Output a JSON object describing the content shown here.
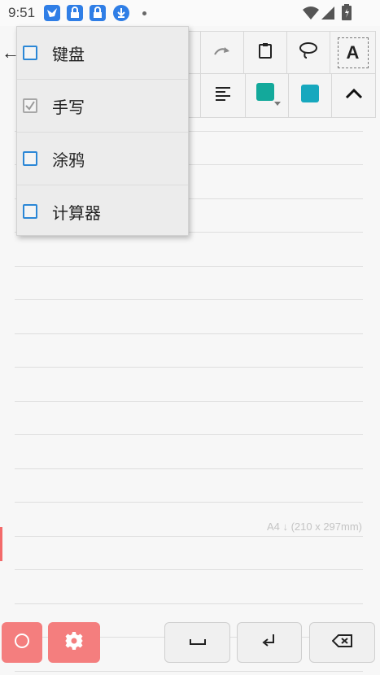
{
  "status_bar": {
    "time": "9:51",
    "icons": [
      "bird-app-icon",
      "lock-app-icon",
      "lock-app-icon",
      "download-icon"
    ],
    "right_icons": [
      "wifi-icon",
      "cell-signal-icon",
      "battery-icon"
    ]
  },
  "toolbar": {
    "row1": [
      "redo-icon",
      "clipboard-icon",
      "lasso-icon",
      "text-box-icon"
    ],
    "row2": [
      "align-left-icon",
      "pen-color-icon",
      "fill-color-icon",
      "collapse-icon"
    ],
    "text_box_letter": "A",
    "colors": {
      "pen": "#13a99b",
      "fill": "#17a8be"
    }
  },
  "menu": {
    "items": [
      {
        "label": "键盘",
        "checked": false
      },
      {
        "label": "手写",
        "checked": true
      },
      {
        "label": "涂鸦",
        "checked": false
      },
      {
        "label": "计算器",
        "checked": false
      }
    ]
  },
  "paper": {
    "size_label": "A4 ↓ (210 x 297mm)"
  },
  "bottom_bar": {
    "left_buttons": [
      "circle-icon",
      "gear-icon"
    ],
    "right_buttons": [
      "space-icon",
      "enter-icon",
      "backspace-icon"
    ],
    "accent": "#f47e7e"
  }
}
